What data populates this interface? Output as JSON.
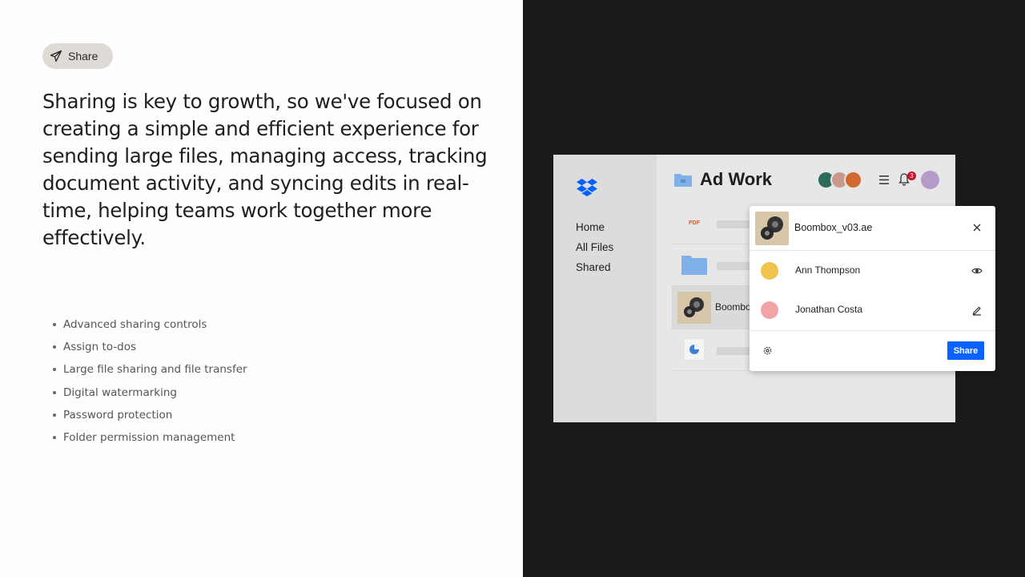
{
  "pill": {
    "label": "Share",
    "icon": "paper-plane-icon"
  },
  "headline": "Sharing is key to growth, so we've focused on creating a simple and efficient experience for sending large files, managing access, tracking document activity, and syncing edits in real-time, helping teams work together more effectively.",
  "features": [
    "Advanced sharing controls",
    "Assign to-dos",
    "Large file sharing and file transfer",
    "Digital watermarking",
    "Password protection",
    "Folder permission management"
  ],
  "app": {
    "nav": [
      "Home",
      "All Files",
      "Shared"
    ],
    "title": "Ad Work",
    "notification_count": "3",
    "partial_file_name": "Boombo",
    "pdf_label": "PDF",
    "colors": {
      "brand_blue": "#0061FE",
      "badge_red": "#C8102E"
    }
  },
  "popup": {
    "file_name": "Boombox_v03.ae",
    "people": [
      {
        "name": "Ann Thompson",
        "permission_icon": "eye-icon"
      },
      {
        "name": "Jonathan Costa",
        "permission_icon": "pencil-icon"
      }
    ],
    "share_label": "Share"
  }
}
